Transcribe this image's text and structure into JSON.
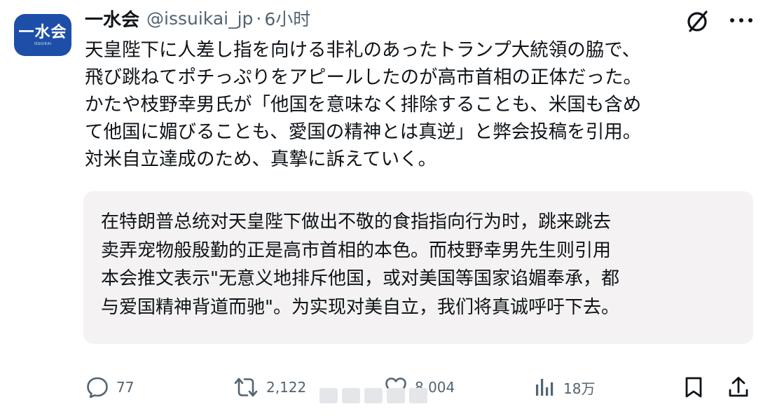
{
  "author": {
    "display_name": "一水会",
    "handle": "@issuikai_jp",
    "separator": "·",
    "time": "6小时",
    "avatar_text": "一水会",
    "avatar_subtext": "ISSUIKAI",
    "avatar_color": "#1d4fa8"
  },
  "tweet": {
    "lines": [
      "天皇陛下に人差し指を向ける非礼のあったトランプ大統領の脇で、",
      "飛び跳ねてポチっぷりをアピールしたのが高市首相の正体だった。",
      "かたや枝野幸男氏が「他国を意味なく排除することも、米国も含め",
      "て他国に媚びることも、愛国の精神とは真逆」と弊会投稿を引用。",
      "対米自立達成のため、真摯に訴えていく。"
    ]
  },
  "translation": {
    "lines": [
      "在特朗普总统对天皇陛下做出不敬的食指指向行为时，跳来跳去",
      "卖弄宠物般殷勤的正是高市首相的本色。而枝野幸男先生则引用",
      "本会推文表示\"无意义地排斥他国，或对美国等国家谄媚奉承，都",
      "与爱国精神背道而驰\"。为实现对美自立，我们将真诚呼吁下去。"
    ],
    "background": "#f4f2f2"
  },
  "actions": {
    "reply": {
      "icon": "reply-icon",
      "count": "77"
    },
    "retweet": {
      "icon": "retweet-icon",
      "count": "2,122"
    },
    "like": {
      "icon": "heart-icon",
      "count": "8,004"
    },
    "views": {
      "icon": "views-icon",
      "count": "18万"
    },
    "bookmark": {
      "icon": "bookmark-icon"
    },
    "share": {
      "icon": "share-icon"
    }
  },
  "colors": {
    "text": "#0f1419",
    "secondary": "#536471"
  }
}
